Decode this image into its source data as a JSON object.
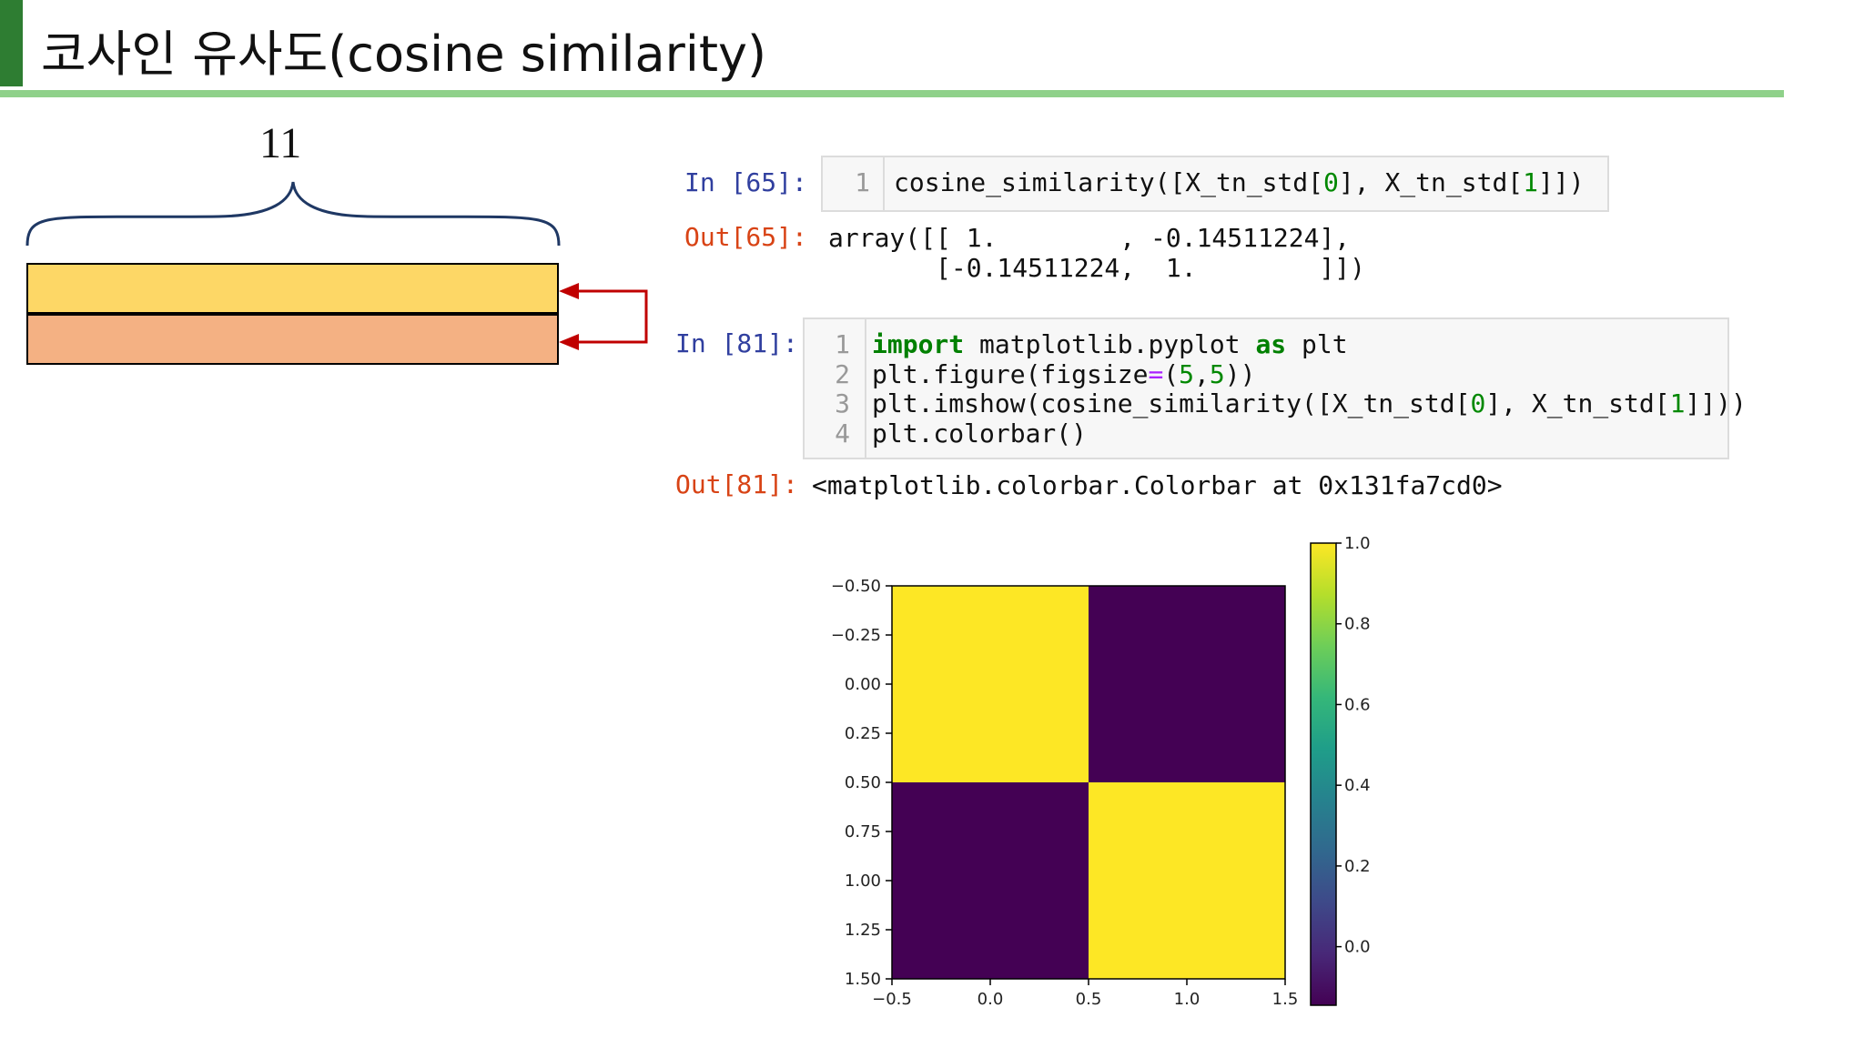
{
  "slide": {
    "title": "코사인 유사도(cosine similarity)",
    "accent_color": "#2e7d32",
    "rule_color": "#8fd18a"
  },
  "diagram": {
    "brace_label": "11",
    "rows": [
      {
        "color": "#fdd766"
      },
      {
        "color": "#f4b183"
      }
    ],
    "arrow_color": "#c00000",
    "brace_color": "#1f3864"
  },
  "notebook": {
    "cells": [
      {
        "in_prompt": "In [65]:",
        "line_numbers": [
          "1"
        ],
        "code_lines": [
          "cosine_similarity([X_tn_std[0], X_tn_std[1]])"
        ],
        "out_prompt": "Out[65]:",
        "output_lines": [
          "array([[ 1.        , -0.14511224],",
          "       [-0.14511224,  1.        ]])"
        ]
      },
      {
        "in_prompt": "In [81]:",
        "line_numbers": [
          "1",
          "2",
          "3",
          "4"
        ],
        "code_lines": [
          "import matplotlib.pyplot as plt",
          "plt.figure(figsize=(5,5))",
          "plt.imshow(cosine_similarity([X_tn_std[0], X_tn_std[1]]))",
          "plt.colorbar()"
        ],
        "out_prompt": "Out[81]:",
        "output_lines": [
          "<matplotlib.colorbar.Colorbar at 0x131fa7cd0>"
        ]
      }
    ]
  },
  "chart_data": {
    "type": "heatmap",
    "matrix": [
      [
        1.0,
        -0.14511224
      ],
      [
        -0.14511224,
        1.0
      ]
    ],
    "x_ticks": [
      "−0.5",
      "0.0",
      "0.5",
      "1.0",
      "1.5"
    ],
    "y_ticks": [
      "−0.50",
      "−0.25",
      "0.00",
      "0.25",
      "0.50",
      "0.75",
      "1.00",
      "1.25",
      "1.50"
    ],
    "xlim": [
      -0.5,
      1.5
    ],
    "ylim": [
      1.5,
      -0.5
    ],
    "colorbar": {
      "ticks": [
        "1.0",
        "0.8",
        "0.6",
        "0.4",
        "0.2",
        "0.0"
      ],
      "range": [
        -0.14511224,
        1.0
      ],
      "colormap": "viridis"
    },
    "colors": {
      "high": "#fde725",
      "low": "#440154"
    }
  }
}
